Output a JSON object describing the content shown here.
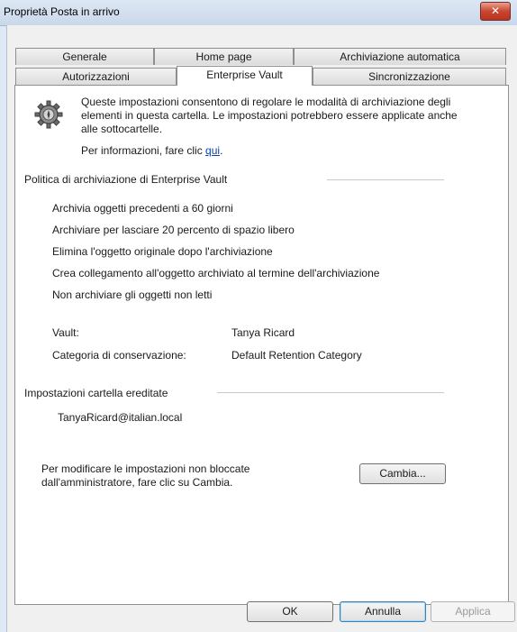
{
  "window": {
    "title": "Proprietà Posta in arrivo",
    "close_glyph": "✕"
  },
  "tabs": {
    "row_back": [
      "Generale",
      "Home page",
      "Archiviazione automatica"
    ],
    "row_front": [
      "Autorizzazioni",
      "Enterprise Vault",
      "Sincronizzazione"
    ],
    "active": "Enterprise Vault"
  },
  "intro": {
    "text": "Queste impostazioni consentono di regolare le modalità di archiviazione degli elementi in questa cartella. Le impostazioni potrebbero essere applicate anche alle sottocartelle.",
    "info_prefix": "Per informazioni, fare clic ",
    "info_link": "qui",
    "info_suffix": ".",
    "icon": "vault-gear-icon"
  },
  "policy": {
    "heading": "Politica di archiviazione di Enterprise Vault",
    "items": [
      "Archivia oggetti precedenti a 60 giorni",
      "Archiviare per lasciare 20 percento di spazio libero",
      "Elimina l'oggetto originale dopo l'archiviazione",
      "Crea collegamento all'oggetto archiviato al termine dell'archiviazione",
      "Non archiviare gli oggetti non letti"
    ],
    "vault_label": "Vault:",
    "vault_value": "Tanya Ricard",
    "retention_label": "Categoria di conservazione:",
    "retention_value": "Default Retention Category"
  },
  "inherited": {
    "heading": "Impostazioni cartella ereditate",
    "email": "TanyaRicard@italian.local"
  },
  "change": {
    "note": "Per modificare le impostazioni non bloccate dall'amministratore, fare clic su Cambia.",
    "button": "Cambia..."
  },
  "footer": {
    "ok": "OK",
    "cancel": "Annulla",
    "apply": "Applica"
  }
}
